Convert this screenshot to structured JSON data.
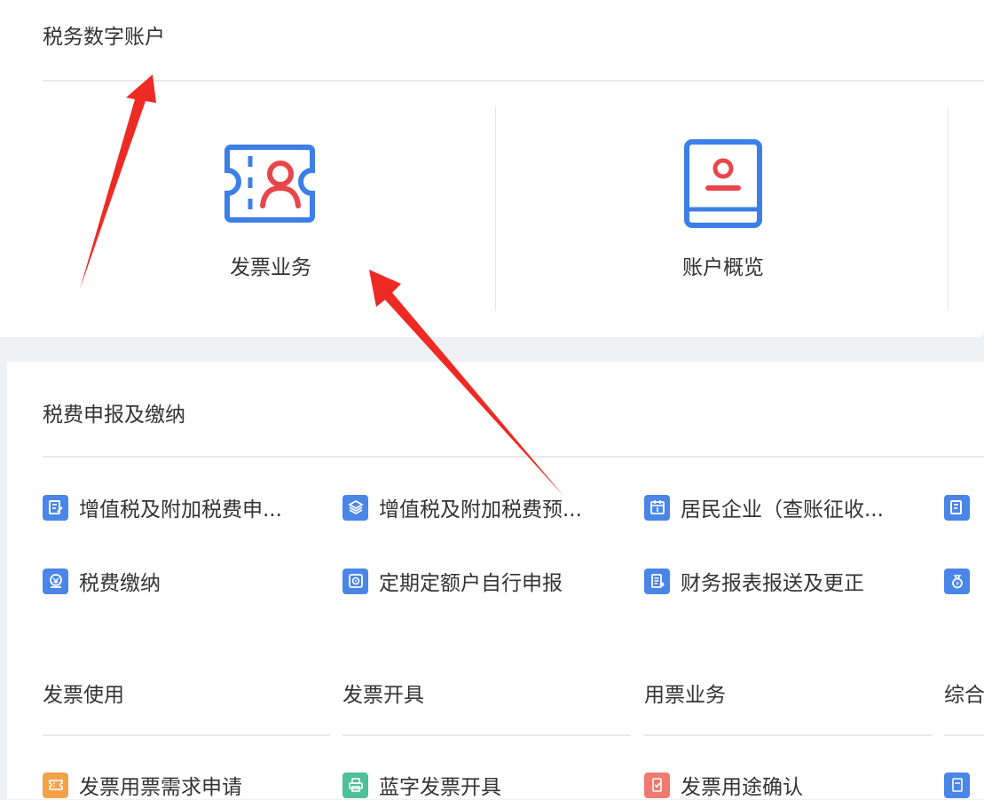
{
  "digital_account": {
    "title": "税务数字账户",
    "tiles": [
      {
        "label": "发票业务",
        "icon": "ticket-user-icon"
      },
      {
        "label": "账户概览",
        "icon": "account-book-icon"
      }
    ]
  },
  "declaration": {
    "title": "税费申报及缴纳",
    "items": [
      {
        "label": "增值税及附加税费申...",
        "icon": "edit-form-icon",
        "color": "#4a86e8"
      },
      {
        "label": "增值税及附加税费预...",
        "icon": "layers-icon",
        "color": "#4a86e8"
      },
      {
        "label": "居民企业（查账征收...",
        "icon": "calendar-icon",
        "color": "#4a86e8"
      },
      {
        "label": "",
        "icon": "edit-form-icon",
        "color": "#4a86e8"
      },
      {
        "label": "税费缴纳",
        "icon": "tax-pay-icon",
        "color": "#4a86e8"
      },
      {
        "label": "定期定额户自行申报",
        "icon": "target-doc-icon",
        "color": "#4a86e8"
      },
      {
        "label": "财务报表报送及更正",
        "icon": "report-doc-icon",
        "color": "#4a86e8"
      },
      {
        "label": "",
        "icon": "money-bag-icon",
        "color": "#4a86e8"
      }
    ]
  },
  "invoice_groups": [
    {
      "title": "发票使用",
      "item": {
        "label": "发票用票需求申请",
        "icon": "ticket-apply-icon",
        "color": "#f5a14a"
      }
    },
    {
      "title": "发票开具",
      "item": {
        "label": "蓝字发票开具",
        "icon": "printer-icon",
        "color": "#4ec09a"
      }
    },
    {
      "title": "用票业务",
      "item": {
        "label": "发票用途确认",
        "icon": "confirm-doc-icon",
        "color": "#f07a70"
      }
    },
    {
      "title": "综合",
      "item": {
        "label": "",
        "icon": "doc-icon",
        "color": "#4a86e8"
      }
    }
  ],
  "theme": {
    "blue": "#3d7fe6",
    "red": "#e8464a",
    "arrow": "#ee2a24"
  }
}
